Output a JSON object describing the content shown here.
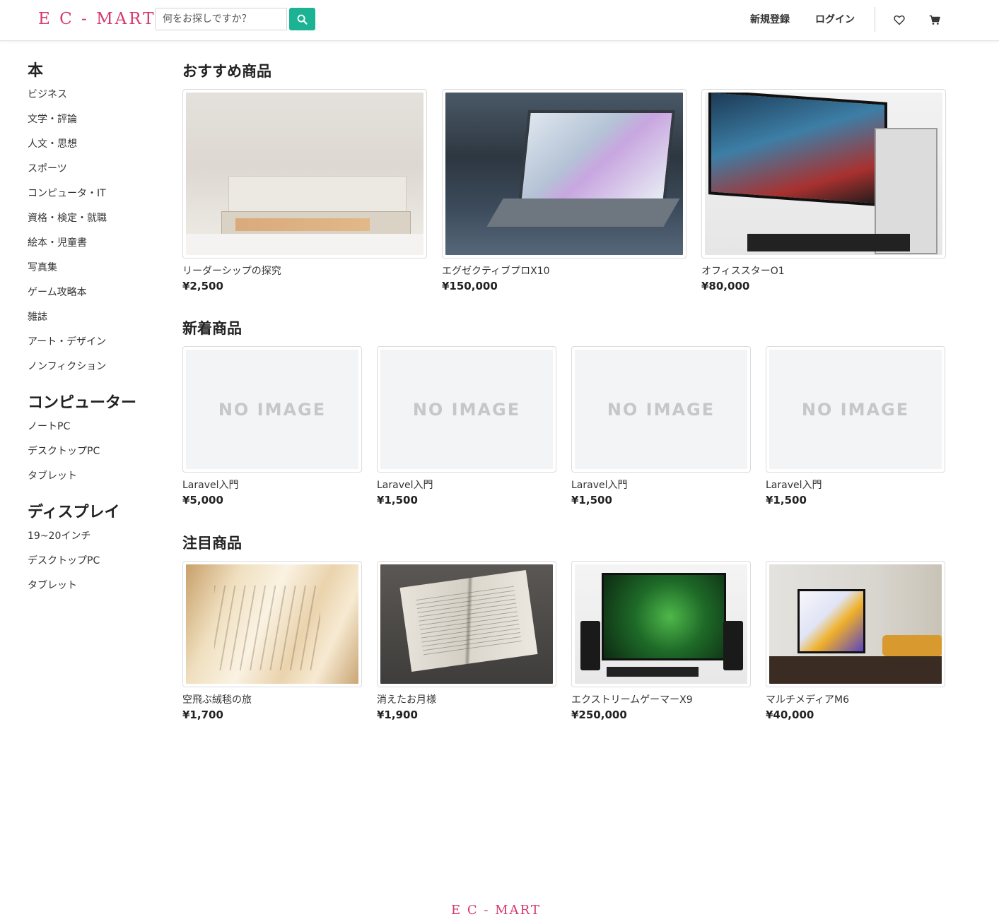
{
  "header": {
    "logo": "E C - MART",
    "search_placeholder": "何をお探しですか？",
    "register_label": "新規登録",
    "login_label": "ログイン"
  },
  "sidebar": {
    "groups": [
      {
        "heading": "本",
        "items": [
          "ビジネス",
          "文学・評論",
          "人文・思想",
          "スポーツ",
          "コンピュータ・IT",
          "資格・検定・就職",
          "絵本・児童書",
          "写真集",
          "ゲーム攻略本",
          "雑誌",
          "アート・デザイン",
          "ノンフィクション"
        ]
      },
      {
        "heading": "コンピューター",
        "items": [
          "ノートPC",
          "デスクトップPC",
          "タブレット"
        ]
      },
      {
        "heading": "ディスプレイ",
        "items": [
          "19~20インチ",
          "デスクトップPC",
          "タブレット"
        ]
      }
    ]
  },
  "sections": {
    "recommended": {
      "title": "おすすめ商品",
      "products": [
        {
          "name": "リーダーシップの探究",
          "price": "¥2,500",
          "image": "books-stack-photo"
        },
        {
          "name": "エグゼクティブプロX10",
          "price": "¥150,000",
          "image": "laptop-photo"
        },
        {
          "name": "オフィススターO1",
          "price": "¥80,000",
          "image": "monitor-pc-photo"
        }
      ]
    },
    "new": {
      "title": "新着商品",
      "no_image_label": "NO IMAGE",
      "products": [
        {
          "name": "Laravel入門",
          "price": "¥5,000"
        },
        {
          "name": "Laravel入門",
          "price": "¥1,500"
        },
        {
          "name": "Laravel入門",
          "price": "¥1,500"
        },
        {
          "name": "Laravel入門",
          "price": "¥1,500"
        }
      ]
    },
    "featured": {
      "title": "注目商品",
      "products": [
        {
          "name": "空飛ぶ絨毯の旅",
          "price": "¥1,700",
          "image": "book-pages-photo"
        },
        {
          "name": "消えたお月様",
          "price": "¥1,900",
          "image": "open-book-photo"
        },
        {
          "name": "エクストリームゲーマーX9",
          "price": "¥250,000",
          "image": "gaming-monitor-photo"
        },
        {
          "name": "マルチメディアM6",
          "price": "¥40,000",
          "image": "desk-monitor-photo"
        }
      ]
    }
  },
  "footer": {
    "logo": "E C - MART"
  },
  "colors": {
    "brand": "#d6376f",
    "accent": "#1bb394"
  }
}
